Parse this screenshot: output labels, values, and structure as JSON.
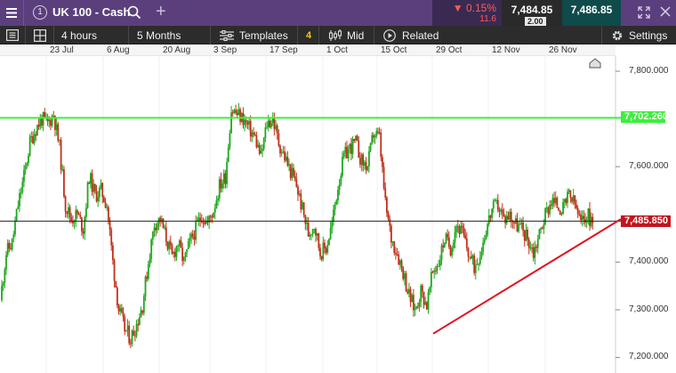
{
  "header": {
    "instrument_number": "1",
    "title": "UK 100 - Cash",
    "change_pct": "▼ 0.15%",
    "change_abs": "11.6",
    "sell_price": "7,484.85",
    "buy_price": "7,486.85",
    "spread": "2.00"
  },
  "toolbar": {
    "interval": "4 hours",
    "range": "5 Months",
    "templates_label": "Templates",
    "templates_badge": "4",
    "price_type": "Mid",
    "related_label": "Related",
    "settings_label": "Settings"
  },
  "date_axis": {
    "labels": [
      "23 Jul",
      "6 Aug",
      "20 Aug",
      "3 Sep",
      "17 Sep",
      "1 Oct",
      "15 Oct",
      "29 Oct",
      "12 Nov",
      "26 Nov"
    ]
  },
  "price_axis": {
    "labels": [
      "7,800.000",
      "7,600.000",
      "7,400.000",
      "7,300.000",
      "7,200.000"
    ],
    "ticks": [
      7800,
      7600,
      7400,
      7300,
      7200
    ]
  },
  "markers": {
    "resistance_level": 7702.26,
    "resistance_label": "7,702.260",
    "current_price": 7485.85,
    "current_label": "7,485.850"
  },
  "trendline": {
    "start_date": "29 Oct",
    "start_price": 7250,
    "end_price": 7490
  },
  "colors": {
    "top_bar": "#5b3f7d",
    "up_candle": "#1fa81f",
    "down_candle": "#c0321c",
    "resistance": "#3cf03c",
    "trendline": "#e0101e",
    "current_price": "#c3141e"
  },
  "chart_data": {
    "type": "candlestick",
    "y_range": [
      7180,
      7850
    ],
    "x": [
      "Jul 15",
      "Jul 16",
      "Jul 17",
      "Jul 18",
      "Jul 19",
      "Jul 22",
      "Jul 23",
      "Jul 24",
      "Jul 25",
      "Jul 26",
      "Jul 29",
      "Jul 30",
      "Jul 31",
      "Aug 1",
      "Aug 2",
      "Aug 5",
      "Aug 6",
      "Aug 7",
      "Aug 8",
      "Aug 9",
      "Aug 12",
      "Aug 13",
      "Aug 14",
      "Aug 15",
      "Aug 16",
      "Aug 19",
      "Aug 20",
      "Aug 21",
      "Aug 22",
      "Aug 23",
      "Aug 26",
      "Aug 27",
      "Aug 28",
      "Aug 29",
      "Aug 30",
      "Sep 2",
      "Sep 3",
      "Sep 4",
      "Sep 5",
      "Sep 6",
      "Sep 9",
      "Sep 10",
      "Sep 11",
      "Sep 12",
      "Sep 13",
      "Sep 16",
      "Sep 17",
      "Sep 18",
      "Sep 19",
      "Sep 20",
      "Sep 23",
      "Sep 24",
      "Sep 25",
      "Sep 26",
      "Sep 27",
      "Sep 30",
      "Oct 1",
      "Oct 2",
      "Oct 3",
      "Oct 4",
      "Oct 7",
      "Oct 8",
      "Oct 9",
      "Oct 10",
      "Oct 11",
      "Oct 14",
      "Oct 15",
      "Oct 16",
      "Oct 17",
      "Oct 18",
      "Oct 21",
      "Oct 22",
      "Oct 23",
      "Oct 24",
      "Oct 25",
      "Oct 28",
      "Oct 29",
      "Oct 30",
      "Oct 31",
      "Nov 1",
      "Nov 4",
      "Nov 5",
      "Nov 6",
      "Nov 7",
      "Nov 8",
      "Nov 11",
      "Nov 12",
      "Nov 13",
      "Nov 14",
      "Nov 15",
      "Nov 18",
      "Nov 19",
      "Nov 20",
      "Nov 21",
      "Nov 22",
      "Nov 25",
      "Nov 26",
      "Nov 27",
      "Nov 28",
      "Nov 29",
      "Dec 2"
    ],
    "close": [
      7320,
      7420,
      7440,
      7520,
      7580,
      7650,
      7680,
      7700,
      7690,
      7710,
      7640,
      7520,
      7490,
      7500,
      7470,
      7580,
      7540,
      7550,
      7520,
      7400,
      7300,
      7260,
      7240,
      7270,
      7310,
      7400,
      7480,
      7490,
      7450,
      7410,
      7440,
      7400,
      7440,
      7470,
      7500,
      7480,
      7510,
      7560,
      7580,
      7720,
      7710,
      7700,
      7680,
      7660,
      7620,
      7690,
      7700,
      7650,
      7620,
      7590,
      7560,
      7510,
      7460,
      7480,
      7420,
      7430,
      7480,
      7560,
      7620,
      7640,
      7650,
      7610,
      7600,
      7670,
      7660,
      7520,
      7450,
      7420,
      7380,
      7330,
      7300,
      7340,
      7310,
      7380,
      7400,
      7450,
      7430,
      7480,
      7460,
      7420,
      7390,
      7420,
      7470,
      7510,
      7520,
      7490,
      7500,
      7480,
      7470,
      7450,
      7420,
      7460,
      7500,
      7530,
      7520,
      7510,
      7540,
      7520,
      7480,
      7500,
      7485
    ]
  }
}
